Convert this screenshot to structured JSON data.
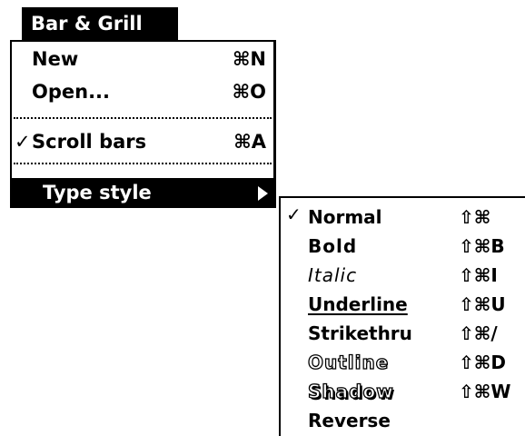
{
  "menu_bar": {
    "title": "Bar & Grill"
  },
  "menu": {
    "items": [
      {
        "label": "New",
        "shortcut": "⌘N"
      },
      {
        "label": "Open...",
        "shortcut": "⌘O"
      },
      {
        "label": "Scroll bars",
        "shortcut": "⌘A",
        "checked": true,
        "check_mark": "✓"
      },
      {
        "label": "Type style",
        "has_submenu": true,
        "highlighted": true
      }
    ]
  },
  "submenu": {
    "items": [
      {
        "label": "Normal",
        "shortcut": "⇧⌘",
        "checked": true,
        "check_mark": "✓"
      },
      {
        "label": "Bold",
        "shortcut": "⇧⌘B"
      },
      {
        "label": "Italic",
        "shortcut": "⇧⌘I"
      },
      {
        "label": "Underline",
        "shortcut": "⇧⌘U"
      },
      {
        "label": "Strikethru",
        "shortcut": "⇧⌘/"
      },
      {
        "label": "Outline",
        "shortcut": "⇧⌘D"
      },
      {
        "label": "Shadow",
        "shortcut": "⇧⌘W"
      },
      {
        "label": "Reverse",
        "shortcut": ""
      }
    ]
  }
}
